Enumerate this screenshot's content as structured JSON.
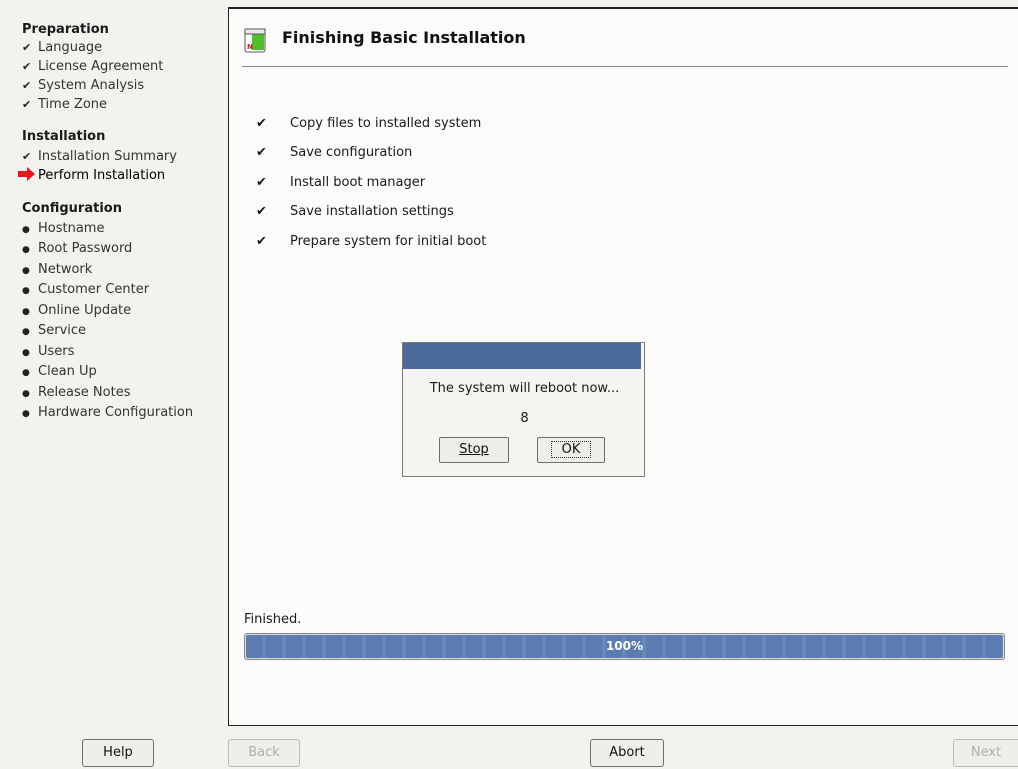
{
  "sidebar": {
    "sections": [
      {
        "title": "Preparation"
      },
      {
        "title": "Installation"
      },
      {
        "title": "Configuration"
      }
    ],
    "preparation_steps": [
      "Language",
      "License Agreement",
      "System Analysis",
      "Time Zone"
    ],
    "installation_steps": [
      "Installation Summary",
      "Perform Installation"
    ],
    "configuration_steps": [
      "Hostname",
      "Root Password",
      "Network",
      "Customer Center",
      "Online Update",
      "Service",
      "Users",
      "Clean Up",
      "Release Notes",
      "Hardware Configuration"
    ],
    "current_step": "Perform Installation",
    "check_mark": "✔",
    "bullet_mark": "●",
    "arrow_color": "#e8141a"
  },
  "main": {
    "title": "Finishing Basic Installation",
    "tasks": [
      "Copy files to installed system",
      "Save configuration",
      "Install boot manager",
      "Save installation settings",
      "Prepare system for initial boot"
    ],
    "task_check": "✔"
  },
  "dialog": {
    "message": "The system will reboot now...",
    "countdown": "8",
    "stop_label": "Stop",
    "ok_label": "OK",
    "titlebar_color": "#4a6a9a"
  },
  "progress": {
    "status": "Finished.",
    "percent_label": "100%",
    "value": 1.0
  },
  "buttons": {
    "help": "Help",
    "back": "Back",
    "abort": "Abort",
    "next": "Next"
  }
}
